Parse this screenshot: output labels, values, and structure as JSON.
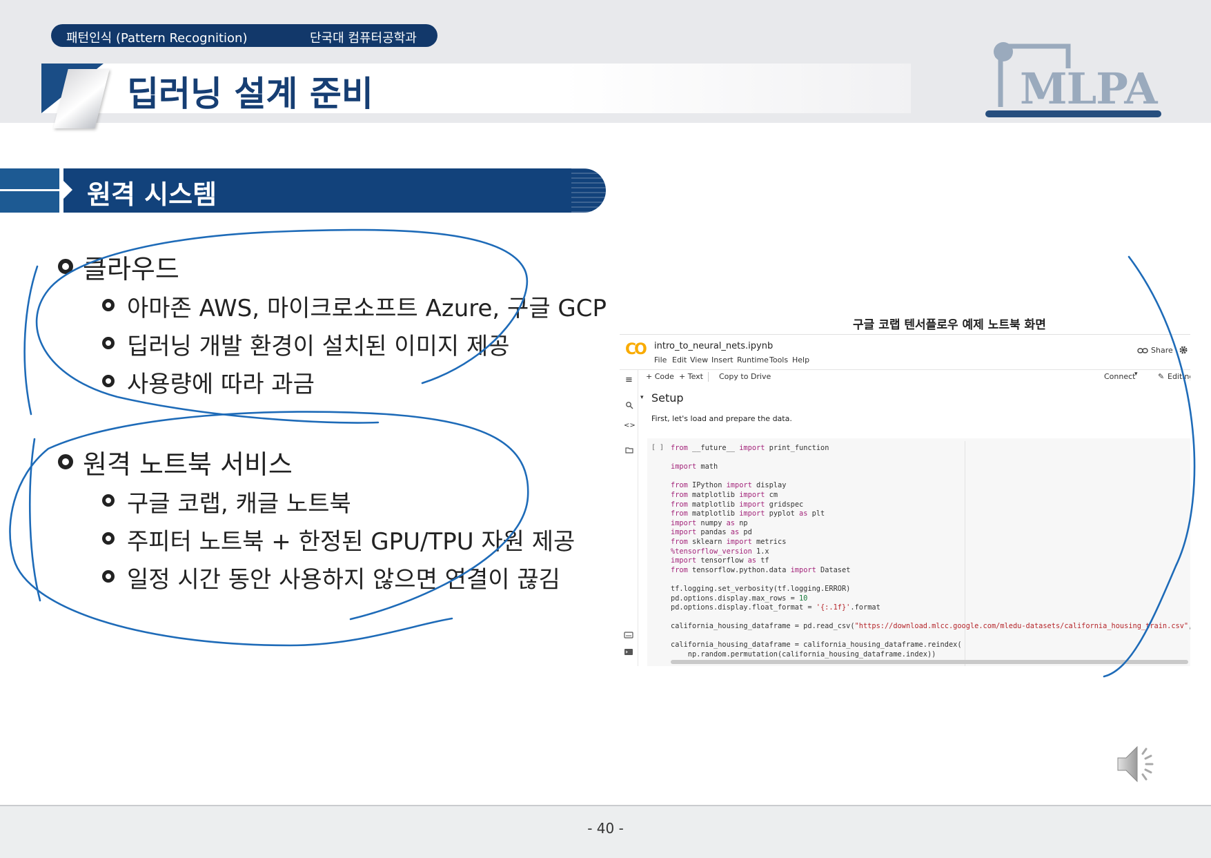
{
  "header": {
    "course": "패턴인식 (Pattern Recognition)",
    "department": "단국대 컴퓨터공학과",
    "page_title": "딥러닝 설계 준비",
    "logo_text": "MLPA"
  },
  "section": {
    "title": "원격 시스템"
  },
  "bullets": [
    {
      "label": "클라우드",
      "items": [
        "아마존 AWS, 마이크로소프트 Azure, 구글 GCP",
        "딥러닝 개발 환경이 설치된 이미지 제공",
        "사용량에 따라 과금"
      ]
    },
    {
      "label": "원격 노트북 서비스",
      "items": [
        "구글 코랩, 캐글 노트북",
        "주피터 노트북 + 한정된 GPU/TPU 자원 제공",
        "일정 시간 동안 사용하지 않으면 연결이 끊김"
      ]
    }
  ],
  "figure": {
    "caption": "구글 코랩 텐서플로우 예제 노트북 화면",
    "colab": {
      "logo": "CO",
      "filename": "intro_to_neural_nets.ipynb",
      "menu": [
        "File",
        "Edit",
        "View",
        "Insert",
        "Runtime",
        "Tools",
        "Help"
      ],
      "share": "Share",
      "toolbar": {
        "code": "+ Code",
        "text": "+ Text",
        "copy": "Copy to Drive",
        "connect": "Connect",
        "editing": "Editing"
      },
      "section_heading": "Setup",
      "intro_text": "First, let's load and prepare the data.",
      "cell_marker": "[ ]",
      "code_lines": [
        "from __future__ import print_function",
        "",
        "import math",
        "",
        "from IPython import display",
        "from matplotlib import cm",
        "from matplotlib import gridspec",
        "from matplotlib import pyplot as plt",
        "import numpy as np",
        "import pandas as pd",
        "from sklearn import metrics",
        "%tensorflow_version 1.x",
        "import tensorflow as tf",
        "from tensorflow.python.data import Dataset",
        "",
        "tf.logging.set_verbosity(tf.logging.ERROR)",
        "pd.options.display.max_rows = 10",
        "pd.options.display.float_format = '{:.1f}'.format",
        "",
        "california_housing_dataframe = pd.read_csv(\"https://download.mlcc.google.com/mledu-datasets/california_housing_train.csv\", se",
        "",
        "california_housing_dataframe = california_housing_dataframe.reindex(",
        "    np.random.permutation(california_housing_dataframe.index))"
      ]
    }
  },
  "footer": {
    "page_number": "- 40 -"
  },
  "colors": {
    "navy": "#12386a",
    "section_blue": "#12427b",
    "ink_blue": "#1e6bb8",
    "colab_orange": "#f9ab00"
  },
  "icons": {
    "speaker": "speaker-icon",
    "search": "search-icon",
    "code": "code-icon",
    "folder": "folder-icon",
    "toc": "toc-icon",
    "gear": "gear-icon",
    "link": "link-icon",
    "pencil": "pencil-icon"
  }
}
